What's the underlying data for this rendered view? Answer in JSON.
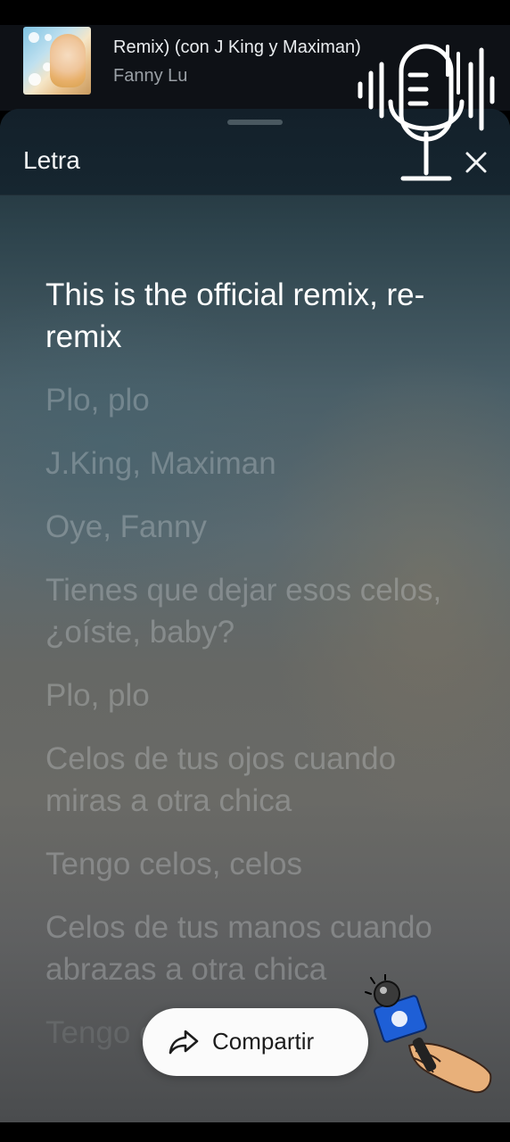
{
  "now_playing": {
    "title": "Remix) (con J King y Maximan)",
    "artist": "Fanny Lu"
  },
  "sheet": {
    "title": "Letra",
    "close_icon": "close-icon"
  },
  "lyrics": [
    {
      "text": "This is the official remix, re-remix",
      "state": "active"
    },
    {
      "text": "Plo, plo",
      "state": "upcoming"
    },
    {
      "text": "J.King, Maximan",
      "state": "upcoming"
    },
    {
      "text": "Oye, Fanny",
      "state": "upcoming"
    },
    {
      "text": "Tienes que dejar esos celos, ¿oíste, baby?",
      "state": "upcoming"
    },
    {
      "text": "Plo, plo",
      "state": "upcoming"
    },
    {
      "text": "Celos de tus ojos cuando miras a otra chica",
      "state": "upcoming"
    },
    {
      "text": "Tengo celos, celos",
      "state": "upcoming"
    },
    {
      "text": "Celos de tus manos cuando abrazas a otra chica",
      "state": "upcoming"
    },
    {
      "text": "Tengo celos, celos",
      "state": "faded"
    }
  ],
  "share": {
    "label": "Compartir",
    "icon": "share-icon"
  },
  "stickers": {
    "microphone_waveform": "microphone-sticker",
    "hand_microphone": "hand-microphone-sticker"
  },
  "colors": {
    "header_bg": "#13202a",
    "active_lyric": "#ffffff",
    "inactive_lyric": "rgba(225,230,232,0.28)",
    "share_button_bg": "#fbfbfb"
  }
}
